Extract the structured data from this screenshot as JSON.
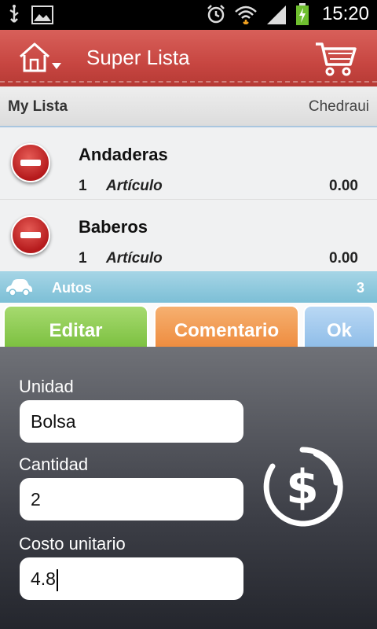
{
  "status_bar": {
    "time": "15:20"
  },
  "header": {
    "title": "Super Lista"
  },
  "list_header": {
    "name": "My Lista",
    "store": "Chedraui"
  },
  "items": [
    {
      "name": "Andaderas",
      "qty": "1",
      "unit": "Artículo",
      "price": "0.00"
    },
    {
      "name": "Baberos",
      "qty": "1",
      "unit": "Artículo",
      "price": "0.00"
    }
  ],
  "category": {
    "name": "Autos",
    "count": "3"
  },
  "actions": {
    "edit": "Editar",
    "comment": "Comentario",
    "ok": "Ok"
  },
  "form": {
    "unit_label": "Unidad",
    "unit_value": "Bolsa",
    "qty_label": "Cantidad",
    "qty_value": "2",
    "cost_label": "Costo unitario",
    "cost_value": "4.8"
  },
  "colors": {
    "header": "#c74641",
    "category": "#7cbfd6",
    "edit": "#7cc040",
    "comment": "#ee8c3f",
    "ok": "#8fbde8"
  }
}
